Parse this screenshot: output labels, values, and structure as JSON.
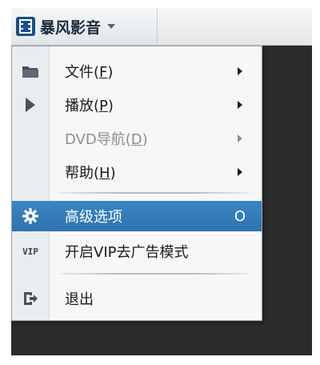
{
  "app": {
    "name": "暴风影音"
  },
  "menu": {
    "items": [
      {
        "label": "文件(",
        "accel": "F",
        "tail": ")"
      },
      {
        "label": "播放(",
        "accel": "P",
        "tail": ")"
      },
      {
        "label": "DVD导航(",
        "accel": "D",
        "tail": ")"
      },
      {
        "label": "帮助(",
        "accel": "H",
        "tail": ")"
      },
      {
        "label": "高级选项",
        "shortcut": "O"
      },
      {
        "label": "开启VIP去广告模式",
        "icon_text": "VIP"
      },
      {
        "label": "退出"
      }
    ]
  },
  "colors": {
    "highlight": "#2f72ad",
    "icon": "#48525c",
    "disabled": "#8e8e8e"
  }
}
